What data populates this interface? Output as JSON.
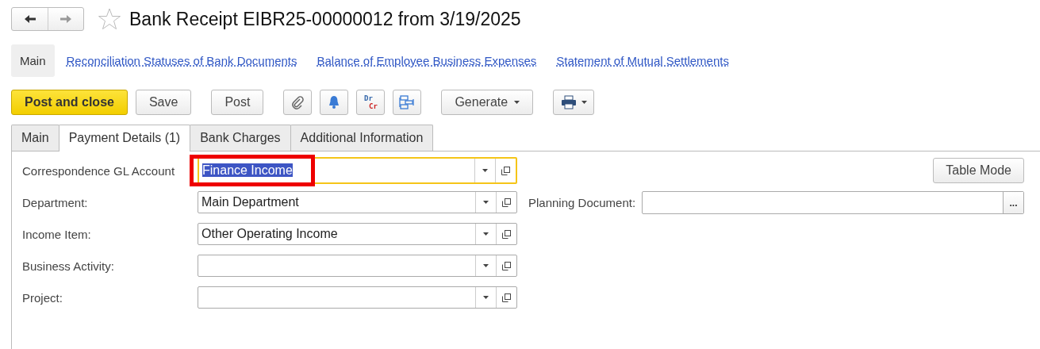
{
  "window": {
    "title": "Bank Receipt EIBR25-00000012 from 3/19/2025",
    "favorite": false
  },
  "nav": [
    {
      "label": "Main",
      "selected": true
    },
    {
      "label": "Reconciliation Statuses of Bank Documents",
      "selected": false
    },
    {
      "label": "Balance of Employee Business Expenses",
      "selected": false
    },
    {
      "label": "Statement of Mutual Settlements",
      "selected": false
    }
  ],
  "toolbar": [
    [
      {
        "kind": "primary",
        "label": "Post and close"
      },
      {
        "kind": "button",
        "label": "Save"
      }
    ],
    [
      {
        "kind": "button",
        "label": "Post"
      }
    ],
    [
      {
        "kind": "paperclip"
      },
      {
        "kind": "bell"
      },
      {
        "kind": "drcr",
        "top": "Dr",
        "bottom": "Cr"
      },
      {
        "kind": "structure"
      }
    ],
    [
      {
        "kind": "menu",
        "label": "Generate"
      }
    ],
    [
      {
        "kind": "print"
      }
    ]
  ],
  "tabs": [
    {
      "label": "Main",
      "selected": false
    },
    {
      "label": "Payment Details (1)",
      "selected": true
    },
    {
      "label": "Bank Charges",
      "selected": false
    },
    {
      "label": "Additional Information",
      "selected": false
    }
  ],
  "fields": [
    {
      "label": "Correspondence GL Account",
      "value": "Finance Income",
      "focused": true,
      "highlighted": true
    },
    {
      "label": "Department:",
      "value": "Main Department",
      "focused": false,
      "highlighted": false
    },
    {
      "label": "Income Item:",
      "value": "Other Operating Income",
      "focused": false,
      "highlighted": false
    },
    {
      "label": "Business Activity:",
      "focused": false,
      "highlighted": false
    },
    {
      "label": "Project:",
      "focused": false,
      "highlighted": false
    }
  ],
  "table_mode_button": "Table Mode",
  "planning_document": {
    "label": "Planning Document:",
    "button": "..."
  }
}
